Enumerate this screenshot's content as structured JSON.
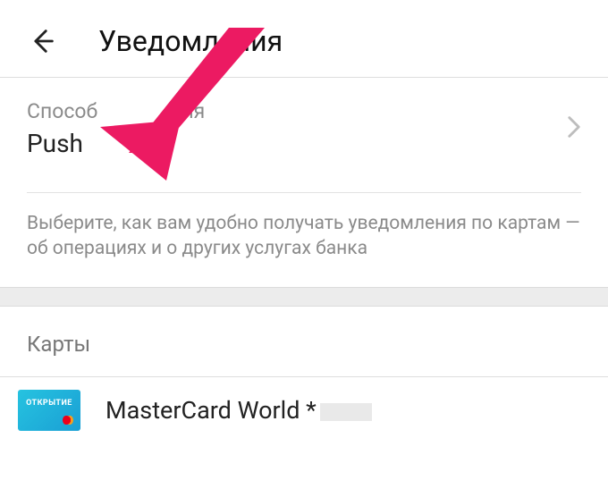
{
  "header": {
    "title": "Уведомления"
  },
  "method": {
    "label": "Способ",
    "label_suffix": "ния",
    "value": "Push"
  },
  "description": "Выберите, как вам удобно получать уведомления по картам — об операциях и о других услугах банка",
  "cards": {
    "header": "Карты",
    "items": [
      {
        "name": "MasterCard World ",
        "mask_prefix": "*",
        "bank_label": "ОТКРЫТИЕ"
      }
    ]
  },
  "colors": {
    "arrow": "#ec1a62"
  }
}
